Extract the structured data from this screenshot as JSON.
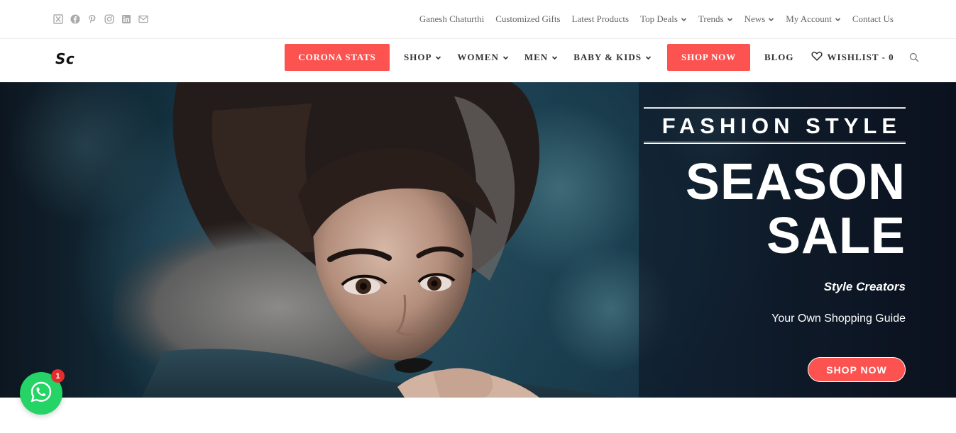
{
  "colors": {
    "accent": "#fc5250",
    "whatsapp": "#25d366",
    "badge": "#e52b2b"
  },
  "social": [
    {
      "name": "x-twitter-icon"
    },
    {
      "name": "facebook-icon"
    },
    {
      "name": "pinterest-icon"
    },
    {
      "name": "instagram-icon"
    },
    {
      "name": "linkedin-icon"
    },
    {
      "name": "mail-icon"
    }
  ],
  "topnav": {
    "ganesh": "Ganesh Chaturthi",
    "gifts": "Customized Gifts",
    "latest": "Latest Products",
    "deals": "Top Deals",
    "trends": "Trends",
    "news": "News",
    "account": "My Account",
    "contact": "Contact Us"
  },
  "header": {
    "logo": "Sc",
    "corona": "CORONA STATS",
    "shop": "SHOP",
    "women": "WOMEN",
    "men": "MEN",
    "baby": "BABY & KIDS",
    "shop_now": "SHOP NOW",
    "blog": "BLOG",
    "wishlist": "WISHLIST - 0"
  },
  "hero": {
    "kicker": "FASHION STYLE",
    "line1": "SEASON",
    "line2": "SALE",
    "tagline": "Style Creators",
    "subtitle": "Your Own Shopping Guide",
    "cta": "SHOP NOW"
  },
  "whatsapp": {
    "badge": "1"
  }
}
